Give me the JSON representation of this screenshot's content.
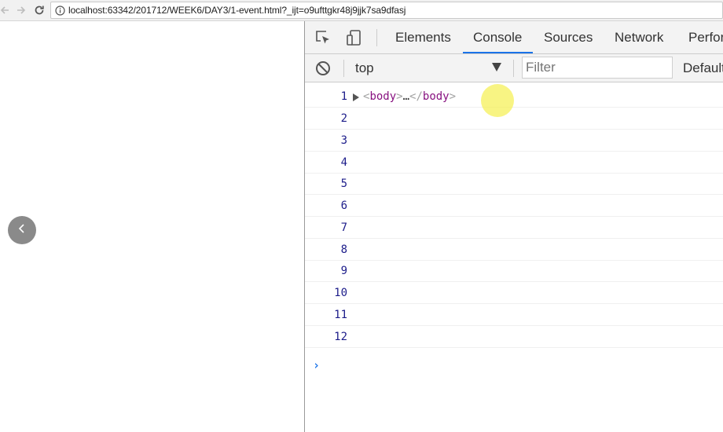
{
  "browser": {
    "url": "localhost:63342/201712/WEEK6/DAY3/1-event.html?_ijt=o9ufttgkr48j9jjk7sa9dfasj",
    "back_icon": "arrow-left-icon",
    "forward_icon": "arrow-right-icon",
    "reload_icon": "reload-icon",
    "info_icon": "info-icon"
  },
  "page": {
    "back_button_icon": "chevron-left-icon"
  },
  "devtools": {
    "tabs": [
      {
        "label": "Elements",
        "active": false
      },
      {
        "label": "Console",
        "active": true
      },
      {
        "label": "Sources",
        "active": false
      },
      {
        "label": "Network",
        "active": false
      },
      {
        "label": "Perfor",
        "active": false
      }
    ],
    "toolbar": {
      "context": "top",
      "filter_placeholder": "Filter",
      "levels_label": "Default"
    },
    "accent_color": "#1a73e8",
    "console": {
      "rows": [
        {
          "line": "1",
          "open_tag_start": "<",
          "open_tag": "body",
          "open_tag_end": ">",
          "ellipsis": "…",
          "close_tag_start": "</",
          "close_tag": "body",
          "close_tag_end": ">"
        },
        {
          "line": "2"
        },
        {
          "line": "3"
        },
        {
          "line": "4"
        },
        {
          "line": "5"
        },
        {
          "line": "6"
        },
        {
          "line": "7"
        },
        {
          "line": "8"
        },
        {
          "line": "9"
        },
        {
          "line": "10"
        },
        {
          "line": "11"
        },
        {
          "line": "12"
        }
      ],
      "prompt": "›"
    }
  }
}
